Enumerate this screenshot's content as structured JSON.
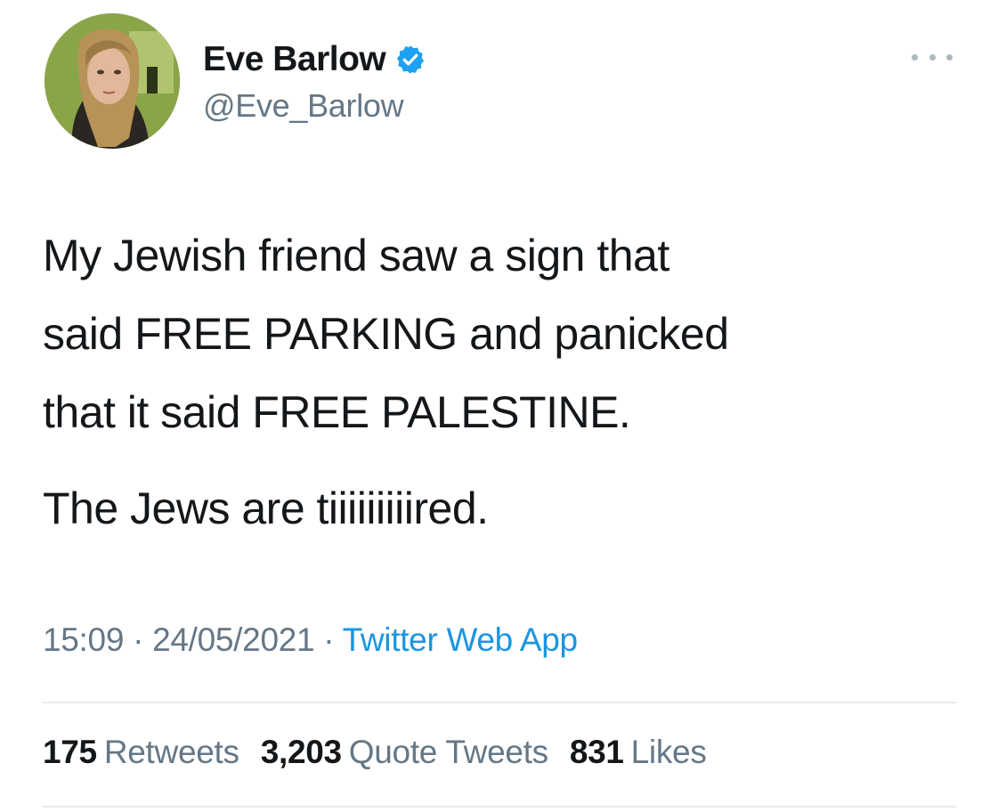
{
  "user": {
    "display_name": "Eve Barlow",
    "handle": "@Eve_Barlow",
    "verified": true,
    "avatar_icon": "profile-photo"
  },
  "menu": {
    "icon": "more-options-icon"
  },
  "tweet": {
    "paragraphs": [
      "My Jewish friend saw a sign that\nsaid FREE PARKING and panicked\nthat it said FREE PALESTINE.",
      "The Jews are tiiiiiiiiired."
    ],
    "time": "15:09",
    "separator": "·",
    "date": "24/05/2021",
    "source": "Twitter Web App"
  },
  "stats": {
    "retweets_count": "175",
    "retweets_label": "Retweets",
    "quotes_count": "3,203",
    "quotes_label": "Quote Tweets",
    "likes_count": "831",
    "likes_label": "Likes"
  },
  "colors": {
    "text": "#14171a",
    "secondary": "#657786",
    "link": "#1b95e0",
    "verified_badge": "#1da1f2",
    "divider": "#e6ecf0"
  }
}
